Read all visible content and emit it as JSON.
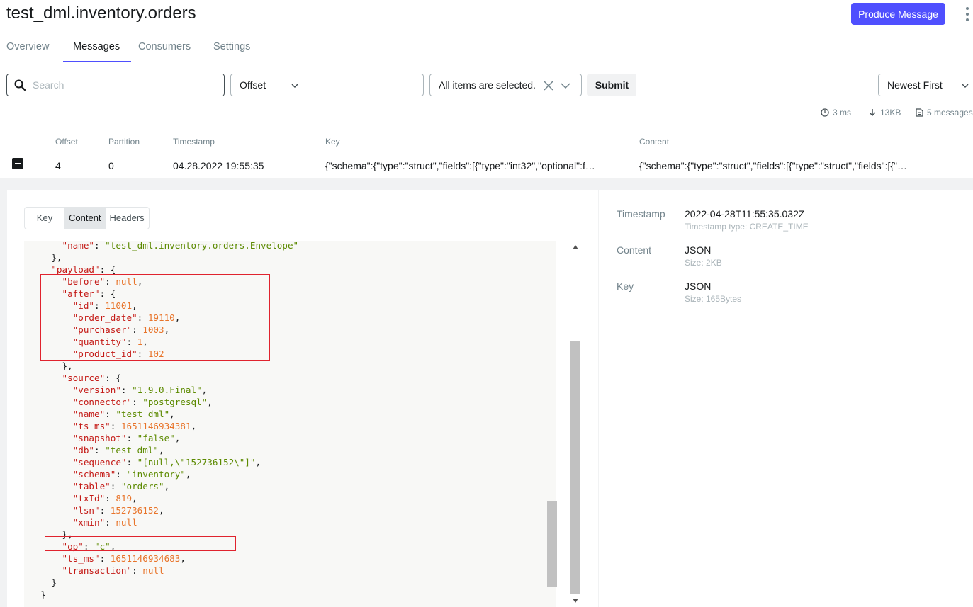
{
  "header": {
    "title": "test_dml.inventory.orders",
    "produce_label": "Produce Message"
  },
  "tabs": [
    {
      "label": "Overview"
    },
    {
      "label": "Messages"
    },
    {
      "label": "Consumers"
    },
    {
      "label": "Settings"
    }
  ],
  "filters": {
    "search_placeholder": "Search",
    "seek_type": "Offset",
    "offset_value": "",
    "partitions": "All items are selected.",
    "submit_label": "Submit",
    "sort": "Newest First"
  },
  "stats": {
    "time": "3 ms",
    "size": "13KB",
    "count": "5 messages"
  },
  "table": {
    "headers": [
      "Offset",
      "Partition",
      "Timestamp",
      "Key",
      "Content"
    ],
    "row": {
      "offset": "4",
      "partition": "0",
      "timestamp": "04.28.2022 19:55:35",
      "key": "{\"schema\":{\"type\":\"struct\",\"fields\":[{\"type\":\"int32\",\"optional\":f…",
      "content": "{\"schema\":{\"type\":\"struct\",\"fields\":[{\"type\":\"struct\",\"fields\":[{\"…"
    }
  },
  "detail": {
    "view_tabs": [
      "Key",
      "Content",
      "Headers"
    ],
    "meta": {
      "timestamp_label": "Timestamp",
      "timestamp_value": "2022-04-28T11:55:35.032Z",
      "timestamp_sub": "Timestamp type: CREATE_TIME",
      "content_label": "Content",
      "content_value": "JSON",
      "content_sub": "Size: 2KB",
      "key_label": "Key",
      "key_value": "JSON",
      "key_sub": "Size: 165Bytes"
    },
    "code_lines": [
      {
        "indent": 3,
        "parts": [
          [
            "key",
            "\"name\""
          ],
          [
            "pun",
            ": "
          ],
          [
            "str",
            "\"test_dml.inventory.orders.Envelope\""
          ]
        ]
      },
      {
        "indent": 2,
        "parts": [
          [
            "pun",
            "},"
          ]
        ]
      },
      {
        "indent": 2,
        "parts": [
          [
            "key",
            "\"payload\""
          ],
          [
            "pun",
            ": {"
          ]
        ]
      },
      {
        "indent": 3,
        "parts": [
          [
            "key",
            "\"before\""
          ],
          [
            "pun",
            ": "
          ],
          [
            "nul",
            "null"
          ],
          [
            "pun",
            ","
          ]
        ]
      },
      {
        "indent": 3,
        "parts": [
          [
            "key",
            "\"after\""
          ],
          [
            "pun",
            ": {"
          ]
        ]
      },
      {
        "indent": 4,
        "parts": [
          [
            "key",
            "\"id\""
          ],
          [
            "pun",
            ": "
          ],
          [
            "num",
            "11001"
          ],
          [
            "pun",
            ","
          ]
        ]
      },
      {
        "indent": 4,
        "parts": [
          [
            "key",
            "\"order_date\""
          ],
          [
            "pun",
            ": "
          ],
          [
            "num",
            "19110"
          ],
          [
            "pun",
            ","
          ]
        ]
      },
      {
        "indent": 4,
        "parts": [
          [
            "key",
            "\"purchaser\""
          ],
          [
            "pun",
            ": "
          ],
          [
            "num",
            "1003"
          ],
          [
            "pun",
            ","
          ]
        ]
      },
      {
        "indent": 4,
        "parts": [
          [
            "key",
            "\"quantity\""
          ],
          [
            "pun",
            ": "
          ],
          [
            "num",
            "1"
          ],
          [
            "pun",
            ","
          ]
        ]
      },
      {
        "indent": 4,
        "parts": [
          [
            "key",
            "\"product_id\""
          ],
          [
            "pun",
            ": "
          ],
          [
            "num",
            "102"
          ]
        ]
      },
      {
        "indent": 3,
        "parts": [
          [
            "pun",
            "},"
          ]
        ]
      },
      {
        "indent": 3,
        "parts": [
          [
            "key",
            "\"source\""
          ],
          [
            "pun",
            ": {"
          ]
        ]
      },
      {
        "indent": 4,
        "parts": [
          [
            "key",
            "\"version\""
          ],
          [
            "pun",
            ": "
          ],
          [
            "str",
            "\"1.9.0.Final\""
          ],
          [
            "pun",
            ","
          ]
        ]
      },
      {
        "indent": 4,
        "parts": [
          [
            "key",
            "\"connector\""
          ],
          [
            "pun",
            ": "
          ],
          [
            "str",
            "\"postgresql\""
          ],
          [
            "pun",
            ","
          ]
        ]
      },
      {
        "indent": 4,
        "parts": [
          [
            "key",
            "\"name\""
          ],
          [
            "pun",
            ": "
          ],
          [
            "str",
            "\"test_dml\""
          ],
          [
            "pun",
            ","
          ]
        ]
      },
      {
        "indent": 4,
        "parts": [
          [
            "key",
            "\"ts_ms\""
          ],
          [
            "pun",
            ": "
          ],
          [
            "num",
            "1651146934381"
          ],
          [
            "pun",
            ","
          ]
        ]
      },
      {
        "indent": 4,
        "parts": [
          [
            "key",
            "\"snapshot\""
          ],
          [
            "pun",
            ": "
          ],
          [
            "str",
            "\"false\""
          ],
          [
            "pun",
            ","
          ]
        ]
      },
      {
        "indent": 4,
        "parts": [
          [
            "key",
            "\"db\""
          ],
          [
            "pun",
            ": "
          ],
          [
            "str",
            "\"test_dml\""
          ],
          [
            "pun",
            ","
          ]
        ]
      },
      {
        "indent": 4,
        "parts": [
          [
            "key",
            "\"sequence\""
          ],
          [
            "pun",
            ": "
          ],
          [
            "str",
            "\"[null,\\\"152736152\\\"]\""
          ],
          [
            "pun",
            ","
          ]
        ]
      },
      {
        "indent": 4,
        "parts": [
          [
            "key",
            "\"schema\""
          ],
          [
            "pun",
            ": "
          ],
          [
            "str",
            "\"inventory\""
          ],
          [
            "pun",
            ","
          ]
        ]
      },
      {
        "indent": 4,
        "parts": [
          [
            "key",
            "\"table\""
          ],
          [
            "pun",
            ": "
          ],
          [
            "str",
            "\"orders\""
          ],
          [
            "pun",
            ","
          ]
        ]
      },
      {
        "indent": 4,
        "parts": [
          [
            "key",
            "\"txId\""
          ],
          [
            "pun",
            ": "
          ],
          [
            "num",
            "819"
          ],
          [
            "pun",
            ","
          ]
        ]
      },
      {
        "indent": 4,
        "parts": [
          [
            "key",
            "\"lsn\""
          ],
          [
            "pun",
            ": "
          ],
          [
            "num",
            "152736152"
          ],
          [
            "pun",
            ","
          ]
        ]
      },
      {
        "indent": 4,
        "parts": [
          [
            "key",
            "\"xmin\""
          ],
          [
            "pun",
            ": "
          ],
          [
            "nul",
            "null"
          ]
        ]
      },
      {
        "indent": 3,
        "parts": [
          [
            "pun",
            "},"
          ]
        ]
      },
      {
        "indent": 3,
        "parts": [
          [
            "key",
            "\"op\""
          ],
          [
            "pun",
            ": "
          ],
          [
            "str",
            "\"c\""
          ],
          [
            "pun",
            ","
          ]
        ]
      },
      {
        "indent": 3,
        "parts": [
          [
            "key",
            "\"ts_ms\""
          ],
          [
            "pun",
            ": "
          ],
          [
            "num",
            "1651146934683"
          ],
          [
            "pun",
            ","
          ]
        ]
      },
      {
        "indent": 3,
        "parts": [
          [
            "key",
            "\"transaction\""
          ],
          [
            "pun",
            ": "
          ],
          [
            "nul",
            "null"
          ]
        ]
      },
      {
        "indent": 2,
        "parts": [
          [
            "pun",
            "}"
          ]
        ]
      },
      {
        "indent": 1,
        "parts": [
          [
            "pun",
            "}"
          ]
        ]
      }
    ]
  },
  "colors": {
    "accent": "#4f4ffe",
    "highlight_box": "#e0232e"
  }
}
